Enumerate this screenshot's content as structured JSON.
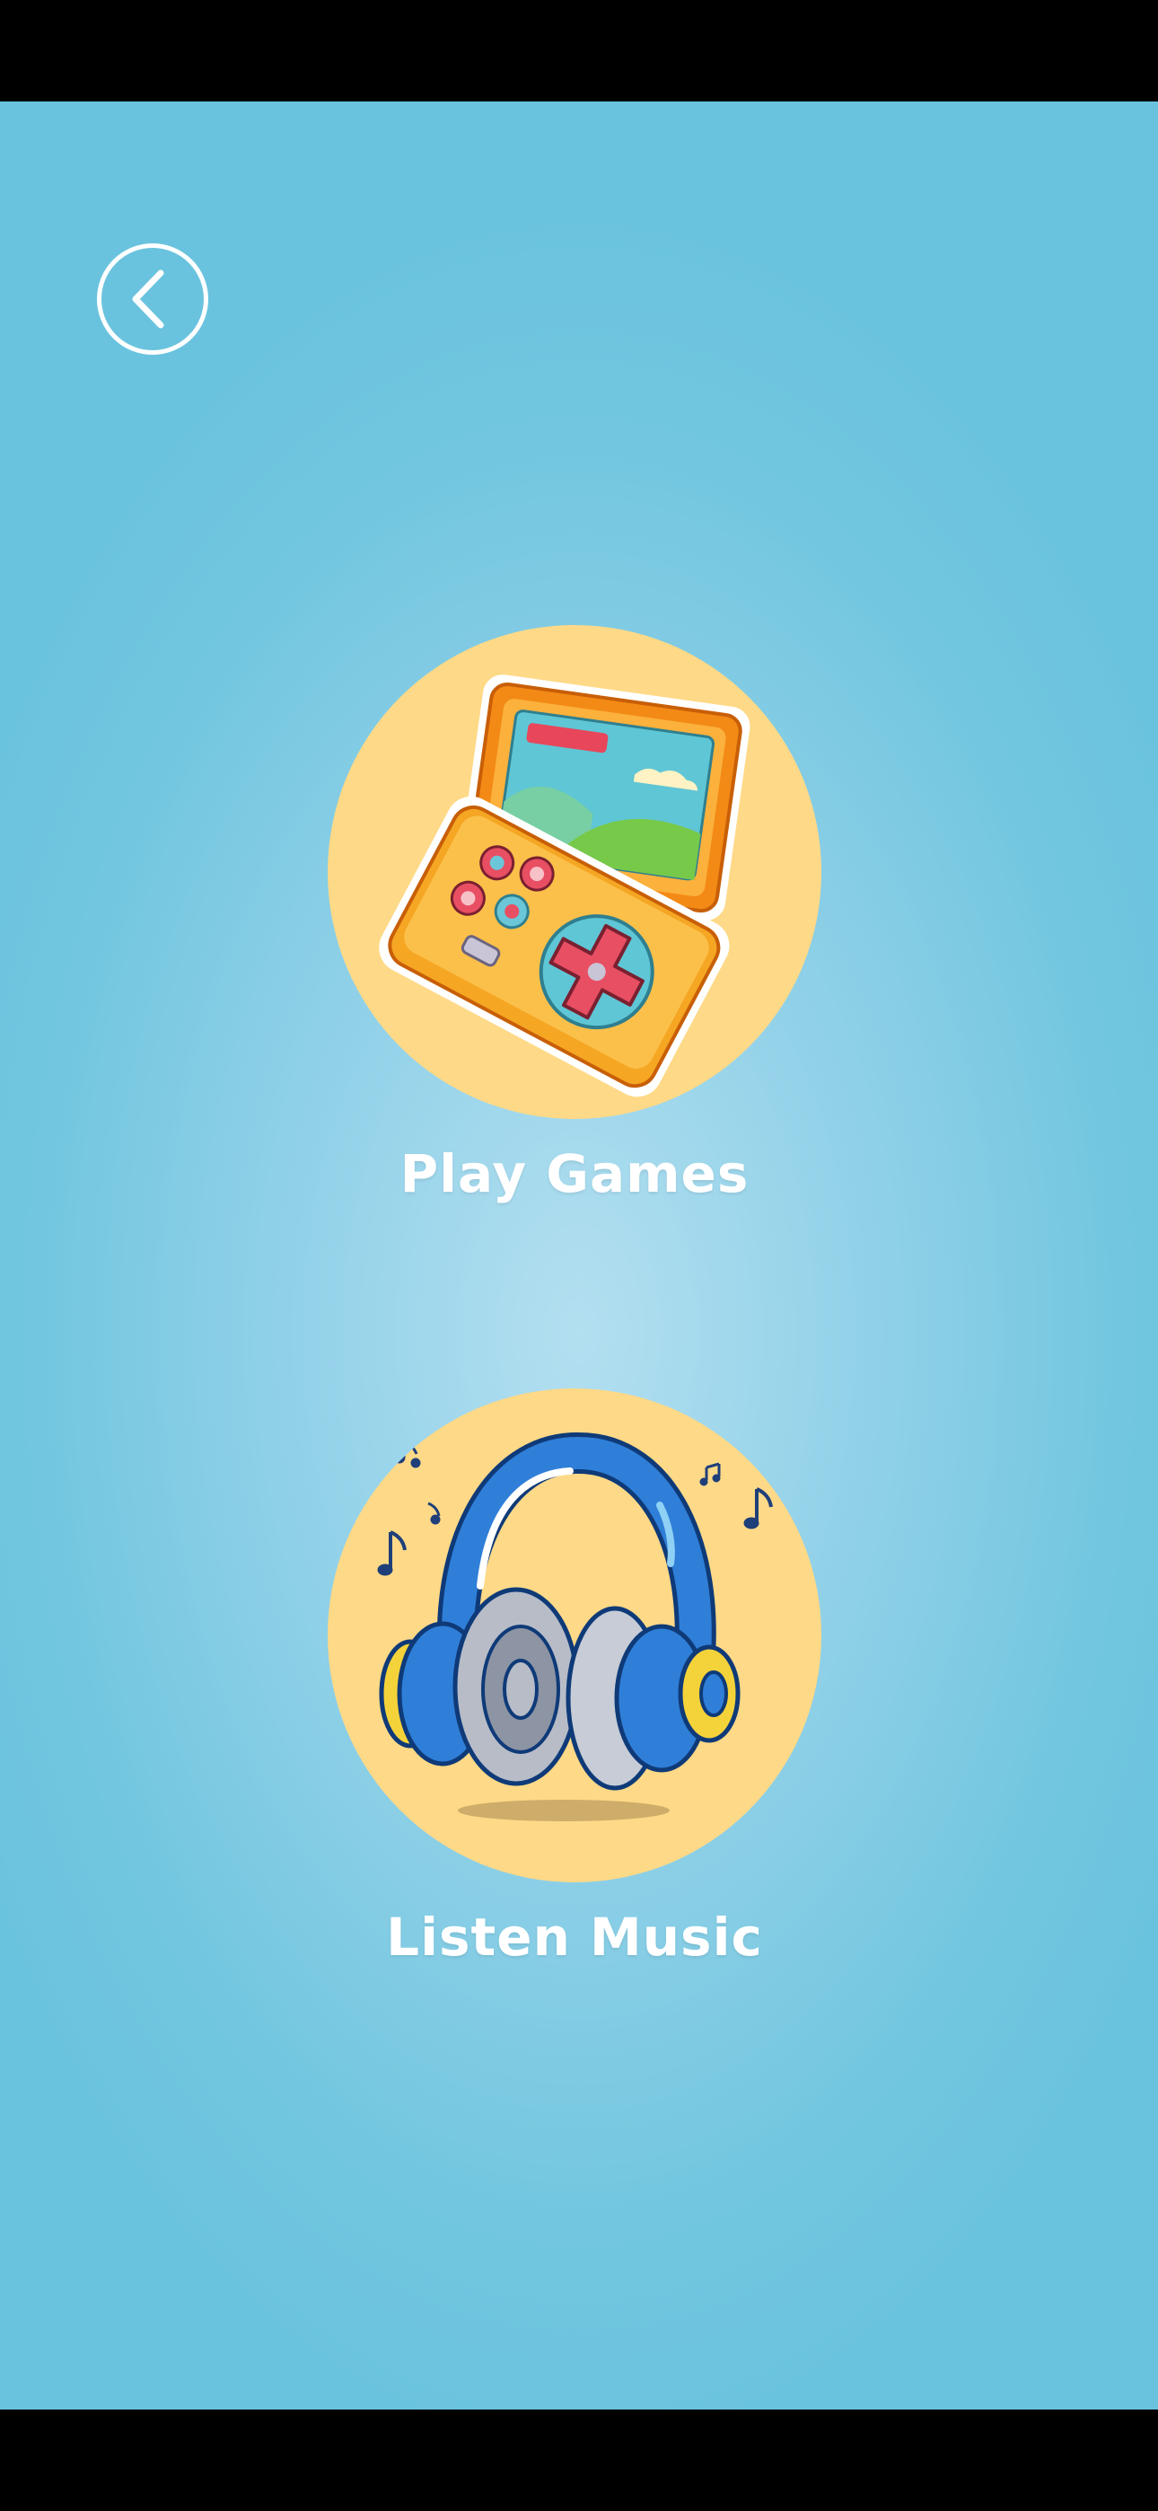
{
  "screen": {
    "background_color": "#72c6df"
  },
  "header": {
    "back_icon": "chevron-left-icon"
  },
  "options": [
    {
      "label": "Play Games",
      "icon": "handheld-game-console-icon",
      "circle_color": "#fed987"
    },
    {
      "label": "Listen Music",
      "icon": "headphones-icon",
      "circle_color": "#fed987"
    }
  ]
}
